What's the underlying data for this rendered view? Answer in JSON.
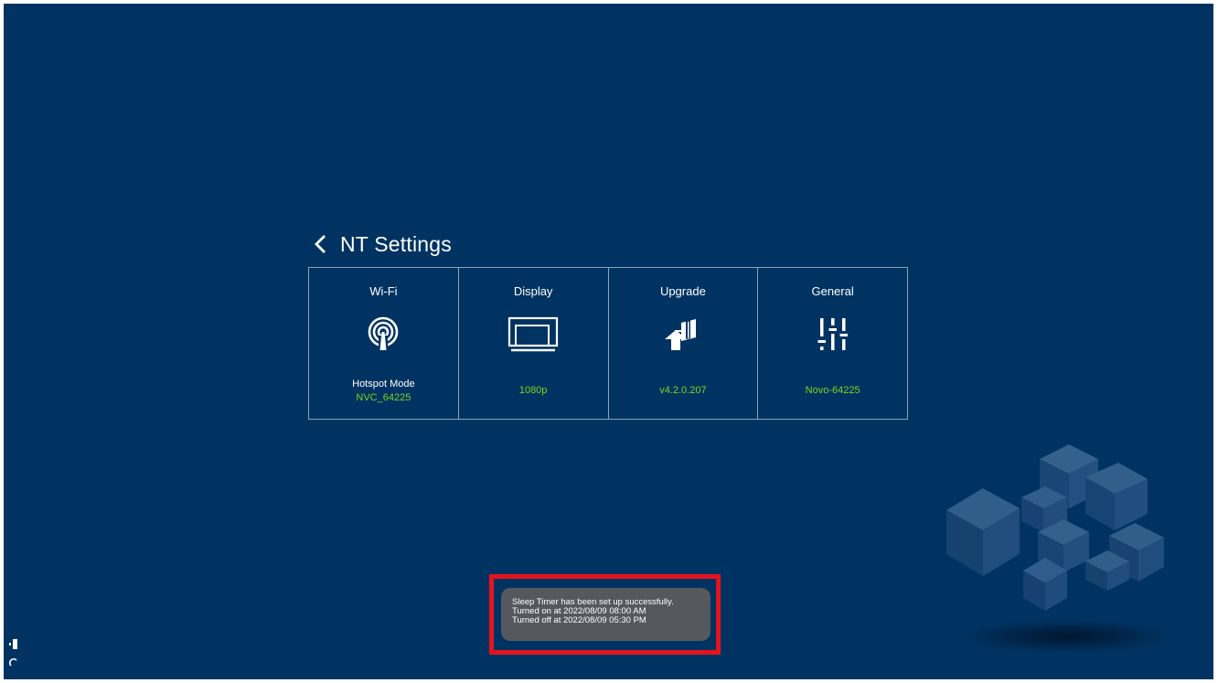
{
  "header": {
    "title": "NT Settings"
  },
  "tiles": [
    {
      "label": "Wi-Fi",
      "icon": "wifi-hotspot-icon",
      "sub": "Hotspot Mode",
      "value": "NVC_64225"
    },
    {
      "label": "Display",
      "icon": "display-icon",
      "value": "1080p"
    },
    {
      "label": "Upgrade",
      "icon": "upgrade-icon",
      "value": "v4.2.0.207"
    },
    {
      "label": "General",
      "icon": "sliders-icon",
      "value": "Novo-64225"
    }
  ],
  "toast": {
    "lines": [
      "Sleep Timer has been set up successfully.",
      "Turned on at 2022/08/09 08:00 AM",
      "Turned off at 2022/08/09 05:30 PM"
    ]
  },
  "colors": {
    "background": "#003361",
    "accent": "#7ed321",
    "highlight": "#e3141d"
  }
}
